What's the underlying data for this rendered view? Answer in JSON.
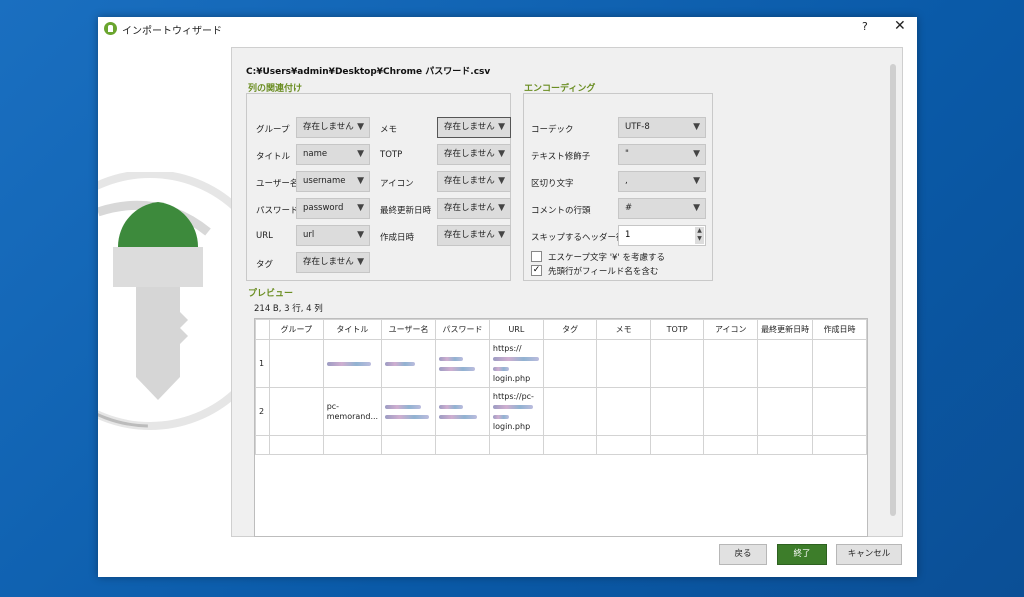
{
  "window": {
    "title": "インポートウィザード",
    "help": "?",
    "close": "✕"
  },
  "file_path": "C:¥Users¥admin¥Desktop¥Chrome パスワード.csv",
  "columns": {
    "label": "列の関連付け",
    "rows": [
      {
        "label": "グループ",
        "value": "存在しません"
      },
      {
        "label": "タイトル",
        "value": "name"
      },
      {
        "label": "ユーザー名",
        "value": "username"
      },
      {
        "label": "パスワード",
        "value": "password"
      },
      {
        "label": "URL",
        "value": "url"
      },
      {
        "label": "タグ",
        "value": "存在しません"
      }
    ],
    "rows_right": [
      {
        "label": "メモ",
        "value": "存在しません"
      },
      {
        "label": "TOTP",
        "value": "存在しません"
      },
      {
        "label": "アイコン",
        "value": "存在しません"
      },
      {
        "label": "最終更新日時",
        "value": "存在しません"
      },
      {
        "label": "作成日時",
        "value": "存在しません"
      }
    ]
  },
  "encoding": {
    "label": "エンコーディング",
    "codec_label": "コーデック",
    "codec": "UTF-8",
    "qualifier_label": "テキスト修飾子",
    "qualifier": "\"",
    "separator_label": "区切り文字",
    "separator": ",",
    "comment_label": "コメントの行頭",
    "comment": "#",
    "skip_label": "スキップするヘッダー行数",
    "skip": "1",
    "escape_label": "エスケープ文字 '¥' を考慮する",
    "escape_checked": false,
    "header_label": "先頭行がフィールド名を含む",
    "header_checked": true
  },
  "preview": {
    "label": "プレビュー",
    "summary": "214 B, 3 行, 4 列",
    "headers": [
      "グループ",
      "タイトル",
      "ユーザー名",
      "パスワード",
      "URL",
      "タグ",
      "メモ",
      "TOTP",
      "アイコン",
      "最終更新日時",
      "作成日時"
    ],
    "rows": [
      {
        "num": "1",
        "url1": "https://",
        "url2": "login.php"
      },
      {
        "num": "2",
        "title1": "pc-",
        "title2": "memorand...",
        "url1": "https://pc-",
        "url2": "login.php"
      }
    ]
  },
  "buttons": {
    "back": "戻る",
    "finish": "終了",
    "cancel": "キャンセル"
  },
  "colors": {
    "accent": "#3d7d2a",
    "group_label": "#6b8e23"
  }
}
